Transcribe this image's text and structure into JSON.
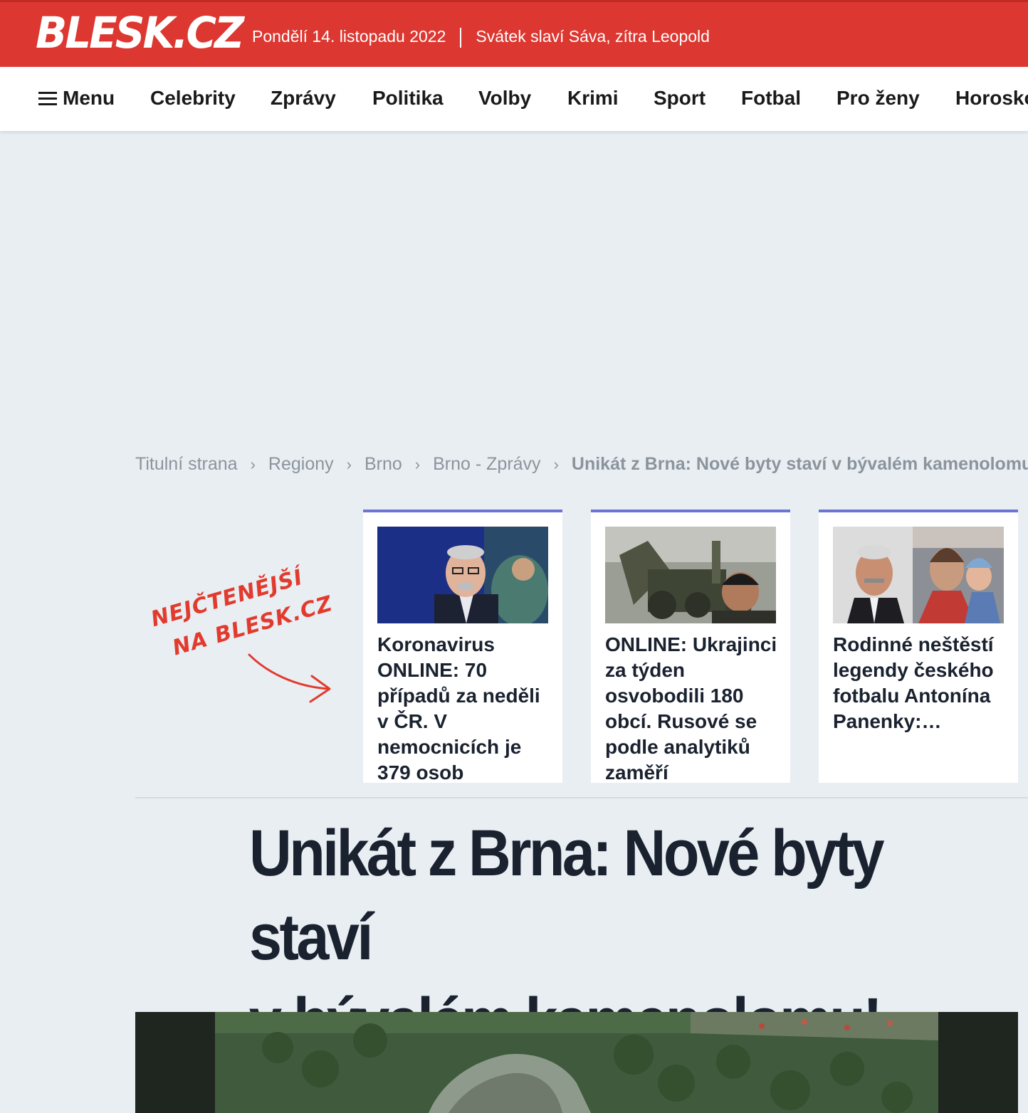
{
  "site": {
    "logo": "BLESK.CZ"
  },
  "topbar": {
    "date": "Pondělí 14. listopadu 2022",
    "nameday": "Svátek slaví Sáva, zítra Leopold"
  },
  "nav": {
    "menu_label": "Menu",
    "items": [
      "Celebrity",
      "Zprávy",
      "Politika",
      "Volby",
      "Krimi",
      "Sport",
      "Fotbal",
      "Pro ženy",
      "Horoskopy"
    ]
  },
  "breadcrumb": [
    "Titulní strana",
    "Regiony",
    "Brno",
    "Brno - Zprávy",
    "Unikát z Brna: Nové byty staví v bývalém kamenolomu!"
  ],
  "most_read": {
    "line1": "NEJČTENĚJŠÍ",
    "line2": "NA BLESK.CZ",
    "cards": [
      {
        "title": "Koronavirus ONLINE: 70 případů za neděli v ČR. V nemocnicích je 379 osob"
      },
      {
        "title": "ONLINE: Ukrajinci za týden osvobodili 180 obcí. Rusové se podle analytiků zaměří"
      },
      {
        "title": "Rodinné neštěstí legendy českého fotbalu Antonína Panenky:…"
      }
    ]
  },
  "article": {
    "headline_line1": "Unikát z Brna: Nové byty staví",
    "headline_line2": "v bývalém kamenolomu!"
  },
  "colors": {
    "brand_red": "#dc3730",
    "card_accent": "#6c74d4",
    "text_dark": "#1a2230"
  }
}
